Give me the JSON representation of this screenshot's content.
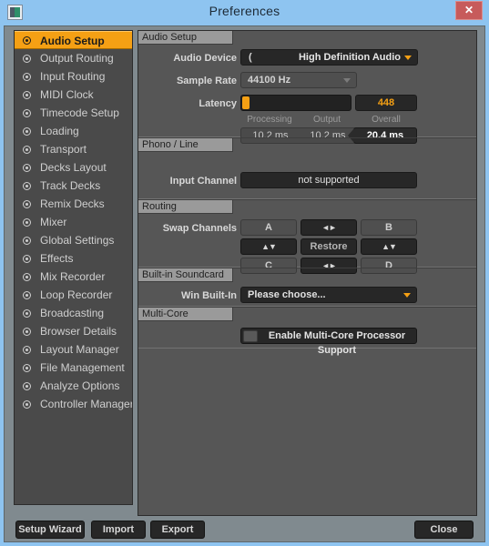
{
  "window": {
    "title": "Preferences",
    "app_icon": "app-window-icon",
    "close_icon": "close-icon",
    "accent_orange": "#f5a014",
    "titlebar_color": "#8ec4f0",
    "panel_color": "#565656"
  },
  "sidebar": {
    "items": [
      {
        "label": "Audio Setup",
        "selected": true
      },
      {
        "label": "Output Routing",
        "selected": false
      },
      {
        "label": "Input Routing",
        "selected": false
      },
      {
        "label": "MIDI Clock",
        "selected": false
      },
      {
        "label": "Timecode Setup",
        "selected": false
      },
      {
        "label": "Loading",
        "selected": false
      },
      {
        "label": "Transport",
        "selected": false
      },
      {
        "label": "Decks Layout",
        "selected": false
      },
      {
        "label": "Track Decks",
        "selected": false
      },
      {
        "label": "Remix Decks",
        "selected": false
      },
      {
        "label": "Mixer",
        "selected": false
      },
      {
        "label": "Global Settings",
        "selected": false
      },
      {
        "label": "Effects",
        "selected": false
      },
      {
        "label": "Mix Recorder",
        "selected": false
      },
      {
        "label": "Loop Recorder",
        "selected": false
      },
      {
        "label": "Broadcasting",
        "selected": false
      },
      {
        "label": "Browser Details",
        "selected": false
      },
      {
        "label": "Layout Manager",
        "selected": false
      },
      {
        "label": "File Management",
        "selected": false
      },
      {
        "label": "Analyze Options",
        "selected": false
      },
      {
        "label": "Controller Manager",
        "selected": false
      }
    ]
  },
  "audio_setup": {
    "header": "Audio Setup",
    "device_label": "Audio Device",
    "device_prefix": "(",
    "device_value": "High Definition Audio",
    "sample_rate_label": "Sample Rate",
    "sample_rate_value": "44100 Hz",
    "latency_label": "Latency",
    "latency_value": "448",
    "latency_columns": [
      "Processing",
      "Output",
      "Overall"
    ],
    "latency_values": [
      "10.2 ms",
      "10.2 ms",
      "20.4 ms"
    ]
  },
  "phono_line": {
    "header": "Phono / Line",
    "input_channel_label": "Input Channel",
    "input_channel_value": "not supported"
  },
  "routing": {
    "header": "Routing",
    "swap_label": "Swap Channels",
    "grid": [
      [
        "A",
        "◄►",
        "B"
      ],
      [
        "▲▼",
        "Restore",
        "▲▼"
      ],
      [
        "C",
        "◄►",
        "D"
      ]
    ]
  },
  "builtin_soundcard": {
    "header": "Built-in Soundcard",
    "label": "Win Built-In",
    "value": "Please choose..."
  },
  "multicore": {
    "header": "Multi-Core",
    "checkbox_label": "Enable Multi-Core Processor Support",
    "checked": false
  },
  "footer": {
    "setup_wizard": "Setup Wizard",
    "import": "Import",
    "export": "Export",
    "close": "Close"
  }
}
